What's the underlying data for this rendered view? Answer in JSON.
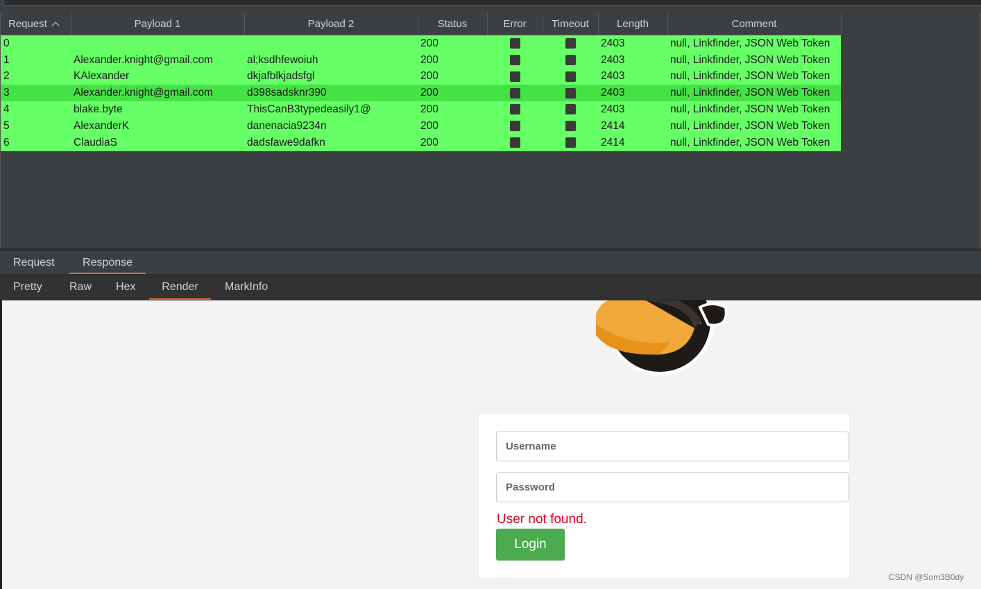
{
  "table": {
    "headers": [
      "Request",
      "Payload 1",
      "Payload 2",
      "Status",
      "Error",
      "Timeout",
      "Length",
      "Comment"
    ],
    "rows": [
      {
        "request": "0",
        "p1": "",
        "p2": "",
        "status": "200",
        "length": "2403",
        "comment": "null, Linkfinder, JSON Web Token"
      },
      {
        "request": "1",
        "p1": "Alexander.knight@gmail.com",
        "p2": "al;ksdhfewoiuh",
        "status": "200",
        "length": "2403",
        "comment": "null, Linkfinder, JSON Web Token"
      },
      {
        "request": "2",
        "p1": "KAlexander",
        "p2": "dkjafblkjadsfgl",
        "status": "200",
        "length": "2403",
        "comment": "null, Linkfinder, JSON Web Token"
      },
      {
        "request": "3",
        "p1": "Alexander.knight@gmail.com",
        "p2": "d398sadsknr390",
        "status": "200",
        "length": "2403",
        "comment": "null, Linkfinder, JSON Web Token"
      },
      {
        "request": "4",
        "p1": "blake.byte",
        "p2": "ThisCanB3typedeasily1@",
        "status": "200",
        "length": "2403",
        "comment": "null, Linkfinder, JSON Web Token"
      },
      {
        "request": "5",
        "p1": "AlexanderK",
        "p2": "danenacia9234n",
        "status": "200",
        "length": "2414",
        "comment": "null, Linkfinder, JSON Web Token"
      },
      {
        "request": "6",
        "p1": "ClaudiaS",
        "p2": "dadsfawe9dafkn",
        "status": "200",
        "length": "2414",
        "comment": "null, Linkfinder, JSON Web Token"
      }
    ],
    "selected_row": "3",
    "sort_icon": "chevron-up-icon"
  },
  "tabs_main": [
    "Request",
    "Response"
  ],
  "tabs_main_active": "Response",
  "tabs_view": [
    "Pretty",
    "Raw",
    "Hex",
    "Render",
    "MarkInfo"
  ],
  "tabs_view_active": "Render",
  "render": {
    "username_placeholder": "Username",
    "password_placeholder": "Password",
    "error": "User not found.",
    "login": "Login"
  },
  "watermark": "CSDN @Som3B0dy",
  "colors": {
    "row_green": "#66ff66",
    "row_selected": "#44e244",
    "accent": "#e06c2b",
    "login_green": "#4caa4f",
    "error_red": "#e3001b"
  }
}
